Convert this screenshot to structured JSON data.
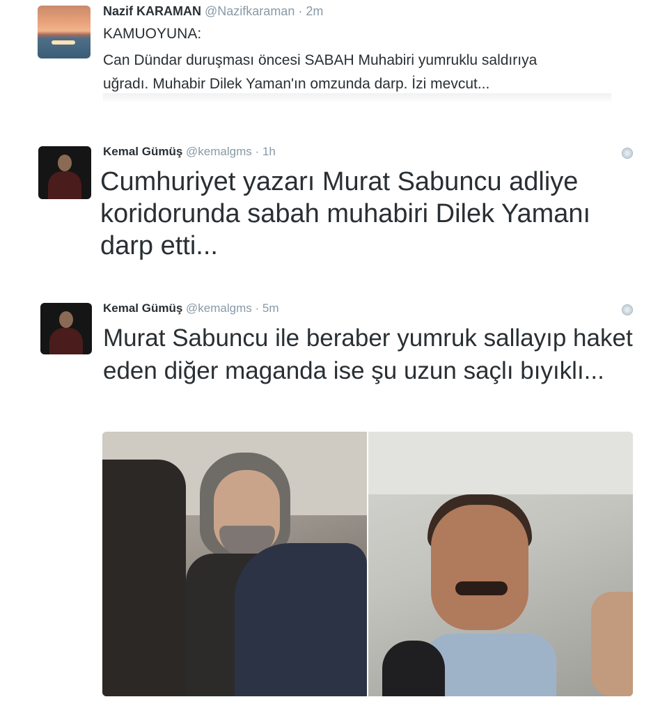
{
  "tweets": [
    {
      "name": "Nazif KARAMAN",
      "handle": "@Nazifkaraman",
      "separator": "·",
      "time": "2m",
      "lines": [
        "KAMUOYUNA:",
        "Can Dündar duruşması öncesi SABAH Muhabiri yumruklu saldırıya",
        "uğradı. Muhabir Dilek Yaman'ın omzunda darp. İzi mevcut..."
      ]
    },
    {
      "name": "Kemal Gümüş",
      "handle": "@kemalgms",
      "separator": "·",
      "time": "1h",
      "text": "Cumhuriyet yazarı Murat Sabuncu adliye koridorunda sabah muhabiri Dilek Yamanı darp etti..."
    },
    {
      "name": "Kemal Gümüş",
      "handle": "@kemalgms",
      "separator": "·",
      "time": "5m",
      "text": "Murat Sabuncu ile beraber yumruk sallayıp haket eden diğer maganda ise şu uzun saçlı bıyıklı..."
    }
  ],
  "icons": {
    "globe": "globe-icon"
  },
  "colors": {
    "text": "#292f33",
    "meta": "#8899a6"
  }
}
